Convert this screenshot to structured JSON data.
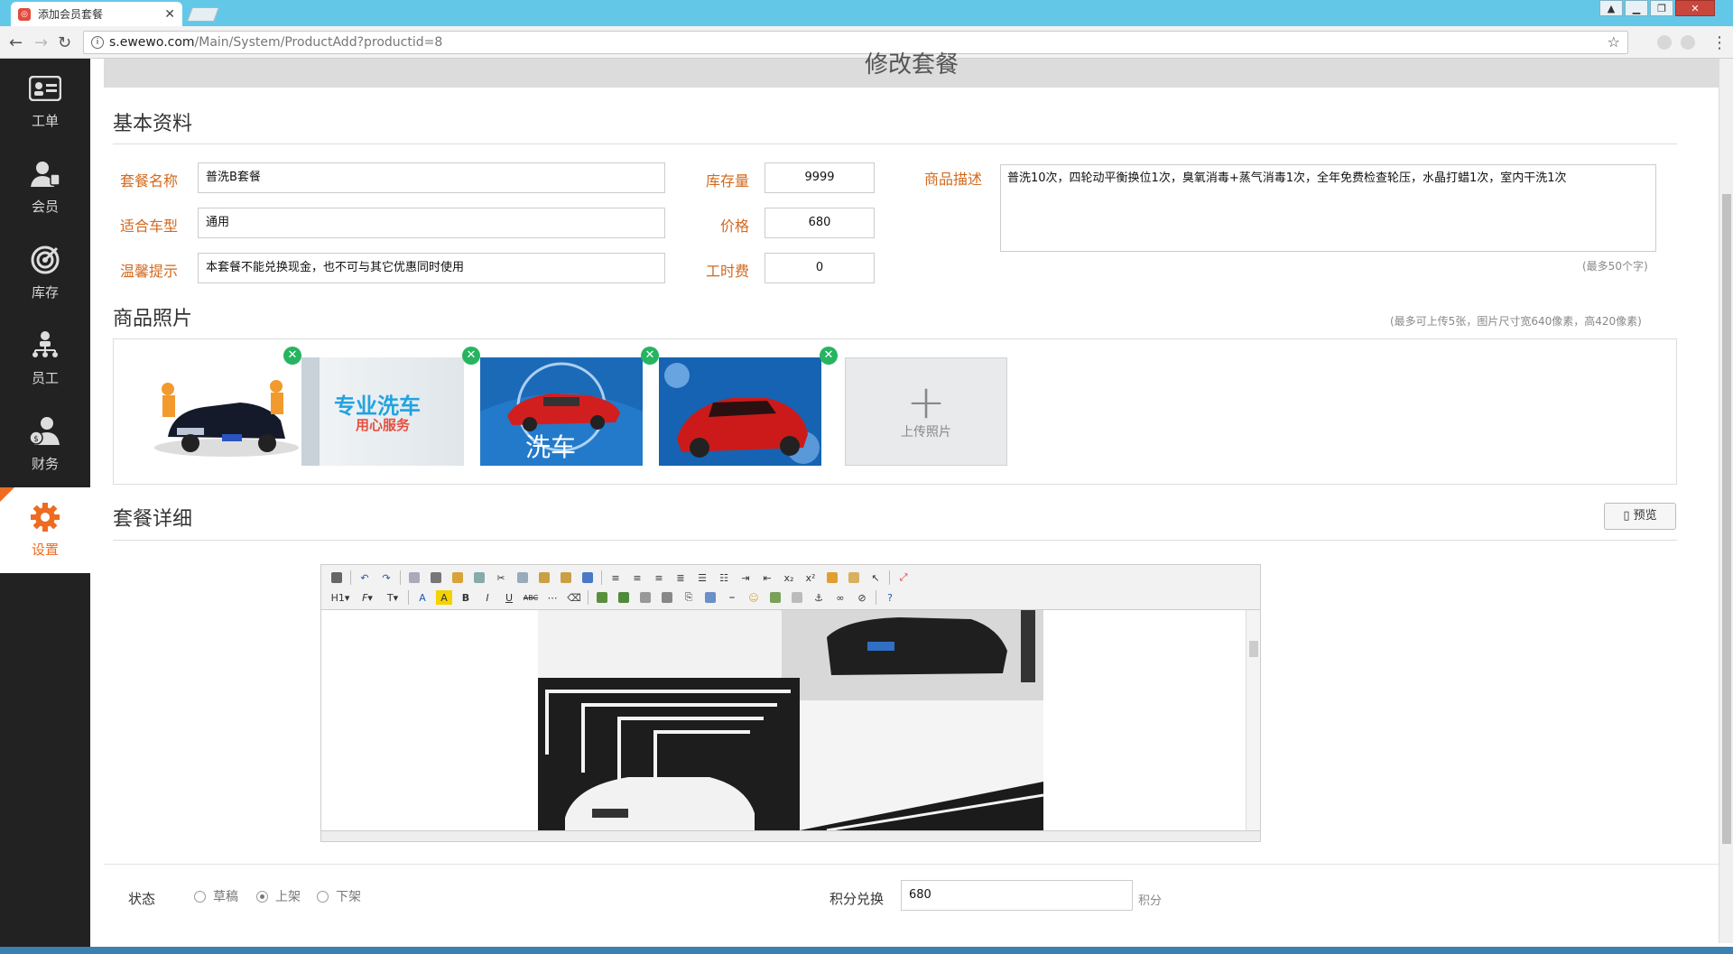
{
  "browser": {
    "tab_title": "添加会员套餐",
    "url_host": "s.ewewo.com",
    "url_path": "/Main/System/ProductAdd?productid=8"
  },
  "sidebar": {
    "items": [
      {
        "label": "工单",
        "icon": "id-card-icon"
      },
      {
        "label": "会员",
        "icon": "member-icon"
      },
      {
        "label": "库存",
        "icon": "target-icon"
      },
      {
        "label": "员工",
        "icon": "org-chart-icon"
      },
      {
        "label": "财务",
        "icon": "finance-icon"
      },
      {
        "label": "设置",
        "icon": "gear-icon"
      }
    ],
    "active_index": 5
  },
  "page": {
    "header": "修改套餐",
    "basic_title": "基本资料",
    "photos_title": "商品照片",
    "photos_hint": "(最多可上传5张，图片尺寸宽640像素，高420像素)",
    "detail_title": "套餐详细",
    "preview_label": "预览"
  },
  "form": {
    "name_label": "套餐名称",
    "name_value": "普洗B套餐",
    "car_label": "适合车型",
    "car_value": "通用",
    "tip_label": "温馨提示",
    "tip_value": "本套餐不能兑换现金，也不可与其它优惠同时使用",
    "stock_label": "库存量",
    "stock_value": "9999",
    "price_label": "价格",
    "price_value": "680",
    "labor_label": "工时费",
    "labor_value": "0",
    "desc_label": "商品描述",
    "desc_value": "普洗10次，四轮动平衡换位1次，臭氧消毒+蒸气消毒1次，全年免费检查轮压，水晶打蜡1次，室内干洗1次",
    "desc_hint": "(最多50个字)"
  },
  "photos": {
    "items": [
      {
        "name": "photo-black-car",
        "caption": ""
      },
      {
        "name": "photo-pro-wash-banner",
        "caption": "专业洗车",
        "subcaption": "用心服务"
      },
      {
        "name": "photo-red-car-splash",
        "caption": "洗车"
      },
      {
        "name": "photo-red-car-water",
        "caption": ""
      }
    ],
    "upload_label": "上传照片"
  },
  "editor": {
    "heading_btn": "H1",
    "font_btn": "F",
    "size_btn": "T"
  },
  "footer": {
    "status_label": "状态",
    "status_options": [
      "草稿",
      "上架",
      "下架"
    ],
    "status_selected": 1,
    "points_label": "积分兑换",
    "points_value": "680",
    "points_unit": "积分"
  },
  "colors": {
    "accent": "#ee6b21",
    "label": "#d2691e",
    "sidebar_bg": "#222222",
    "titlebar": "#63c8e8",
    "green_delete": "#27b460"
  }
}
